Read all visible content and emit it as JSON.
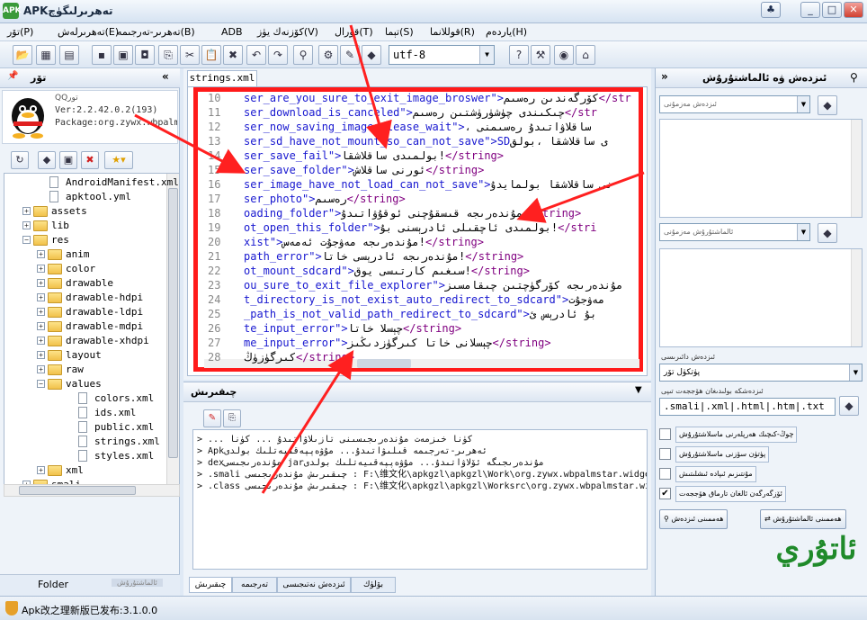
{
  "window": {
    "title": "APKتەھرىرلىگۈچ",
    "app_icon": "apk-icon",
    "buttons": [
      "_",
      "□",
      "✕"
    ]
  },
  "menu": [
    {
      "label": "تۆر(P)"
    },
    {
      "label": "تەھرىرلەش(E)"
    },
    {
      "label": "تەھرىر-تەرجىمە(B)"
    },
    {
      "label": "ADB"
    },
    {
      "label": "كۆزنەك يۈز(V)"
    },
    {
      "label": "قورال(T)"
    },
    {
      "label": "تېما(S)"
    },
    {
      "label": "قوللانما(R)"
    },
    {
      "label": "ياردەم(H)"
    }
  ],
  "toolbar": {
    "encoding": "utf-8"
  },
  "left_panel": {
    "title": "تۆر",
    "apk_name": "QQتور",
    "version": "Ver:2.2.42.0.2(193)",
    "package": "Package:org.zywx.wbpalm",
    "tree": [
      {
        "label": "AndroidManifest.xml",
        "type": "file",
        "depth": 2
      },
      {
        "label": "apktool.yml",
        "type": "file",
        "depth": 2
      },
      {
        "label": "assets",
        "type": "folder",
        "depth": 1
      },
      {
        "label": "lib",
        "type": "folder",
        "depth": 1
      },
      {
        "label": "res",
        "type": "folder",
        "depth": 1,
        "open": true
      },
      {
        "label": "anim",
        "type": "folder",
        "depth": 2
      },
      {
        "label": "color",
        "type": "folder",
        "depth": 2
      },
      {
        "label": "drawable",
        "type": "folder",
        "depth": 2
      },
      {
        "label": "drawable-hdpi",
        "type": "folder",
        "depth": 2
      },
      {
        "label": "drawable-ldpi",
        "type": "folder",
        "depth": 2
      },
      {
        "label": "drawable-mdpi",
        "type": "folder",
        "depth": 2
      },
      {
        "label": "drawable-xhdpi",
        "type": "folder",
        "depth": 2
      },
      {
        "label": "layout",
        "type": "folder",
        "depth": 2
      },
      {
        "label": "raw",
        "type": "folder",
        "depth": 2
      },
      {
        "label": "values",
        "type": "folder",
        "depth": 2,
        "open": true
      },
      {
        "label": "colors.xml",
        "type": "file",
        "depth": 4
      },
      {
        "label": "ids.xml",
        "type": "file",
        "depth": 4
      },
      {
        "label": "public.xml",
        "type": "file",
        "depth": 4
      },
      {
        "label": "strings.xml",
        "type": "file",
        "depth": 4
      },
      {
        "label": "styles.xml",
        "type": "file",
        "depth": 4
      },
      {
        "label": "xml",
        "type": "folder",
        "depth": 2
      },
      {
        "label": "smali",
        "type": "folder",
        "depth": 1
      }
    ],
    "tab_folder": "Folder",
    "tab_other": "ئالماشتۇرۇش"
  },
  "editor": {
    "tab": "strings.xml",
    "lines": [
      {
        "n": "10",
        "name": "ser_are_you_sure_to_exit_image_broswer\">",
        "val": "كۆرگەندىن رەسىم",
        "tail": "</str"
      },
      {
        "n": "11",
        "name": "ser_download_is_canceled\">",
        "val": "چىكىندى چۈشۈرۈشتىن رەسىم",
        "tail": "</str"
      },
      {
        "n": "12",
        "name": "ser_now_saving_image_please_wait\">",
        "val": "، ساقلاۋاتىدۇ رەسىمنى",
        "tail": ""
      },
      {
        "n": "13",
        "name": "ser_sd_have_not_mount_so_can_not_save\">SD",
        "val": "ى ساقلاشقا ،بولق",
        "tail": ""
      },
      {
        "n": "14",
        "name": "ser_save_fail\">",
        "val": "بولمىدى ساقلاشقا!",
        "tail": "</string>"
      },
      {
        "n": "15",
        "name": "ser_save_folder\">",
        "val": "ئورنى ساقلاش",
        "tail": "</string>"
      },
      {
        "n": "16",
        "name": "ser_image_have_not_load_can_not_save\">",
        "val": "نى ساقلاشقا بولمايدۇ",
        "tail": ""
      },
      {
        "n": "17",
        "name": "ser_photo\">",
        "val": "رەسىم",
        "tail": "</string>"
      },
      {
        "n": "18",
        "name": "oading_folder\">",
        "val": "مۇندەرىجە قىسقۇچنى ئوقۇۋاتىدۇ",
        "tail": "</string>"
      },
      {
        "n": "19",
        "name": "ot_open_this_folder\">",
        "val": "بولمىدى ئاچقىلى ئادرېسنى بۇ!",
        "tail": "</stri"
      },
      {
        "n": "20",
        "name": "xist\">",
        "val": "مۇندەرىجە مەۋجۇت ئەمەس!",
        "tail": "</string>"
      },
      {
        "n": "21",
        "name": "path_error\">",
        "val": "مۇندەرىجە ئادرېسى خاتا!",
        "tail": "</string>"
      },
      {
        "n": "22",
        "name": "ot_mount_sdcard\">",
        "val": "سىغىم كارتىسى يوق!",
        "tail": "</string>"
      },
      {
        "n": "23",
        "name": "ou_sure_to_exit_file_explorer\">",
        "val": "مۇندەرىجە كۆرگۈچتىن چىقامسىز",
        "tail": ""
      },
      {
        "n": "24",
        "name": "t_directory_is_not_exist_auto_redirect_to_sdcard\">",
        "val": "مەۋجۇت",
        "tail": ""
      },
      {
        "n": "25",
        "name": "_path_is_not_valid_path_redirect_to_sdcard\">",
        "val": "بۇ ئادرېس ئ",
        "tail": ""
      },
      {
        "n": "26",
        "name": "te_input_error\">",
        "val": "چېسلا خاتا",
        "tail": "</string>"
      },
      {
        "n": "27",
        "name": "me_input_error\">",
        "val": "چېسلانى خاتا كىرگۈزدىڭىز",
        "tail": "</string>"
      },
      {
        "n": "28",
        "name": "",
        "val": "كىرگۈزۈڭ",
        "tail": "</string>"
      }
    ]
  },
  "log": {
    "title": "چىقىرىش",
    "lines": [
      "> ... كۈنا خىزمەت مۇندەرىجىسىنى تازىلاۋاتىدۇ ... كۈنا",
      "> Apkئەھرىر-تەرجىمە قىلىۋاتىدۇ... مۇۋەپپەقىيەتلىك بولدى",
      "> dexمۇندەرىجىسى jarمۇندەرىجىگە ئۆلاۋاتىدۇ... مۇۋەپپەقىيەتلىك بولدى",
      "> .smali چىقىرىش مۇندەرىجىسى : F:\\维文化\\apkgzl\\apkgzl\\Work\\org.zywx.wbpalmstar.widgetone.u",
      "> .class چىقىرىش مۇندەرىجىسى : F:\\维文化\\apkgzl\\apkgzl\\Worksrc\\org.zywx.wbpalmstar.widgetor"
    ],
    "tabs": [
      "چىقىرىش",
      "تەرجىمە",
      "ئىزدەش نەتىجىسى",
      "بۆلۈك"
    ]
  },
  "right_panel": {
    "title": "ئىزدەش ۋە ئالماشتۇرۇش",
    "search_placeholder": "ئىزدەش مەزمۇنى",
    "replace_placeholder": "ئالماشتۇرۇش مەزمۇنى",
    "range_label": "ئىزدەش دائىرىسى",
    "range_value": "پۈتكۈل تۆر",
    "ext_label": "ئىزدەشكە بولىدىغان ھۆججەت تىپى",
    "ext_value": ".smali|.xml|.html|.htm|.txt",
    "checks": [
      {
        "label": "چوڭ-كىچىك ھەرپلەرنى ماسلاشتۇرۇش",
        "checked": false
      },
      {
        "label": "پۈتۈن سۆزنى ماسلاشتۇرۇش",
        "checked": false
      },
      {
        "label": "مۇنتىزىم ئىپادە ئىشلىتىش",
        "checked": false
      },
      {
        "label": "ئۆزگەرگەن ئالغان تارماق ھۆججەت",
        "checked": true
      }
    ],
    "search_btn": "ھەممىنى ئىزدەش",
    "replace_btn": "ھەممىنى ئالماشتۇرۇش"
  },
  "watermark": "ئاتۇري",
  "status": {
    "text": "Apk改之理新版已发布:3.1.0.0"
  },
  "colors": {
    "highlight_border": "#ff1a1a",
    "arrow": "#ff2020",
    "code_name": "#1818d0",
    "code_tag": "#800080"
  }
}
